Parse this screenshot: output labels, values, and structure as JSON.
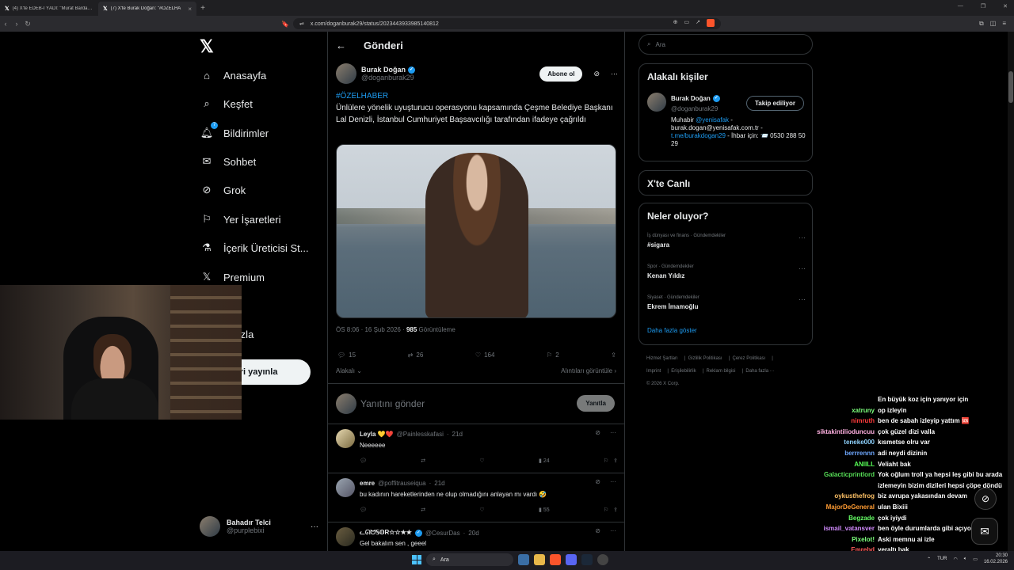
{
  "browser": {
    "tabs": [
      {
        "label": "(4) X'te EDEB-İ YÂDİ: \"Murat Bardakçı"
      },
      {
        "label": "(7) X'te Burak Doğan: \"#ÖZELHA"
      }
    ],
    "url": "x.com/doganburak29/status/2023443933985140812"
  },
  "nav": {
    "items": [
      {
        "label": "Anasayfa"
      },
      {
        "label": "Keşfet"
      },
      {
        "label": "Bildirimler",
        "badge": "7"
      },
      {
        "label": "Sohbet"
      },
      {
        "label": "Grok"
      },
      {
        "label": "Yer İşaretleri"
      },
      {
        "label": "İçerik Üreticisi St..."
      },
      {
        "label": "Premium"
      },
      {
        "label": "fil"
      },
      {
        "label": "a fazla"
      }
    ],
    "post_label": "leri yayınla",
    "profile": {
      "name": "Bahadır Telci",
      "handle": "@purplebixi"
    }
  },
  "main": {
    "title": "Gönderi",
    "author": {
      "name": "Burak Doğan",
      "handle": "@doganburak29"
    },
    "subscribe_label": "Abone ol",
    "hashtag": "#ÖZELHABER",
    "text": "Ünlülere yönelik uyuşturucu operasyonu kapsamında Çeşme Belediye Başkanı Lal Denizli, İstanbul Cumhuriyet Başsavcılığı tarafından ifadeye çağrıldı",
    "time": "ÖS 8:06 · 16 Şub 2026 · ",
    "views": "985",
    "views_label": " Görüntüleme",
    "stats": {
      "replies": "15",
      "reposts": "26",
      "likes": "164",
      "bookmarks": "2"
    },
    "related_label": "Alakalı",
    "quotes_label": "Alıntıları görüntüle",
    "reply_placeholder": "Yanıtını gönder",
    "reply_button": "Yanıtla",
    "replies": [
      {
        "name": "Leyla 💛❤️",
        "handle": "@Painlesskafasi",
        "age": "21d",
        "text": "Neeeeee",
        "views": "24"
      },
      {
        "name": "emre",
        "handle": "@poffitrauseiqua",
        "age": "21d",
        "text": "bu kadının hareketlerinden ne olup olmadığını anlayan mı vardı 🤣",
        "views": "55"
      },
      {
        "name": "ᓚᘏᗢ𝕊𝕆R☆☆★★",
        "handle": "@CesurDas",
        "age": "20d",
        "text": "Gel bakalım sen , geeel",
        "views": ""
      }
    ]
  },
  "right": {
    "search_placeholder": "Ara",
    "related_title": "Alakalı kişiler",
    "related_person": {
      "name": "Burak Doğan",
      "handle": "@doganburak29",
      "follow_label": "Takip ediliyor",
      "bio_1": "Muhabir ",
      "bio_link1": "@yenisafak",
      "bio_2": " - burak.dogan@yenisafak.com.tr - ",
      "bio_link2": "t.me/burakdogan29",
      "bio_3": " - İhbar için: 📨 0530 288 50 29"
    },
    "live_title": "X'te Canlı",
    "trends_title": "Neler oluyor?",
    "trends": [
      {
        "category": "İş dünyası ve finans · Gündemdekiler",
        "topic": "#sigara"
      },
      {
        "category": "Spor · Gündemdekiler",
        "topic": "Kenan Yıldız"
      },
      {
        "category": "Siyaset · Gündemdekiler",
        "topic": "Ekrem İmamoğlu"
      }
    ],
    "show_more": "Daha fazla göster",
    "footer": [
      "Hizmet Şartları",
      "Gizlilik Politikası",
      "Çerez Politikası",
      "Imprint",
      "Erişilebilirlik",
      "Reklam bilgisi",
      "Daha fazla ···",
      "© 2026 X Corp."
    ]
  },
  "chat": [
    {
      "user": "",
      "color": "#ff5c8a",
      "msg": "En büyük koz için yanıyor için"
    },
    {
      "user": "xatruny",
      "color": "#7cff7c",
      "msg": "op izleyin"
    },
    {
      "user": "nimruth",
      "color": "#ff3b3b",
      "msg": "ben de sabah izleyip yattım 🆘"
    },
    {
      "user": "siktakintilioduncuu",
      "color": "#ffb0e0",
      "msg": "çok güzel dizi valla"
    },
    {
      "user": "teneke000",
      "color": "#8fd3ff",
      "msg": "kısmetse olru var"
    },
    {
      "user": "berrrennn",
      "color": "#6fa8ff",
      "msg": "adi neydi dizinin"
    },
    {
      "user": "ANIILL",
      "color": "#57ff57",
      "msg": "Veliaht bak"
    },
    {
      "user": "Galacticprintlord",
      "color": "#57e057",
      "msg": "Yok oğlum troll ya hepsi leş gibi bu arada izlemeyin bizim dizileri hepsi çöpe döndü"
    },
    {
      "user": "oykusthefrog",
      "color": "#ffc266",
      "msg": "biz avrupa yakasından devam"
    },
    {
      "user": "MajorDeGeneral",
      "color": "#ff9c33",
      "msg": "ulan Bixiii"
    },
    {
      "user": "Begzade",
      "color": "#66ff66",
      "msg": "çok iyiydi"
    },
    {
      "user": "ismail_vatansver",
      "color": "#d38cff",
      "msg": "ben öyle durumlarda gibi açıyom ya"
    },
    {
      "user": "Pixelot!",
      "color": "#7cff7c",
      "msg": "Aski memnu ai izle"
    },
    {
      "user": "Emrebd",
      "color": "#ff5c5c",
      "msg": "yeraltı bak"
    }
  ],
  "taskbar": {
    "search": "Ara",
    "lang": "TUR",
    "time": "20:30",
    "date": "16.02.2026"
  }
}
